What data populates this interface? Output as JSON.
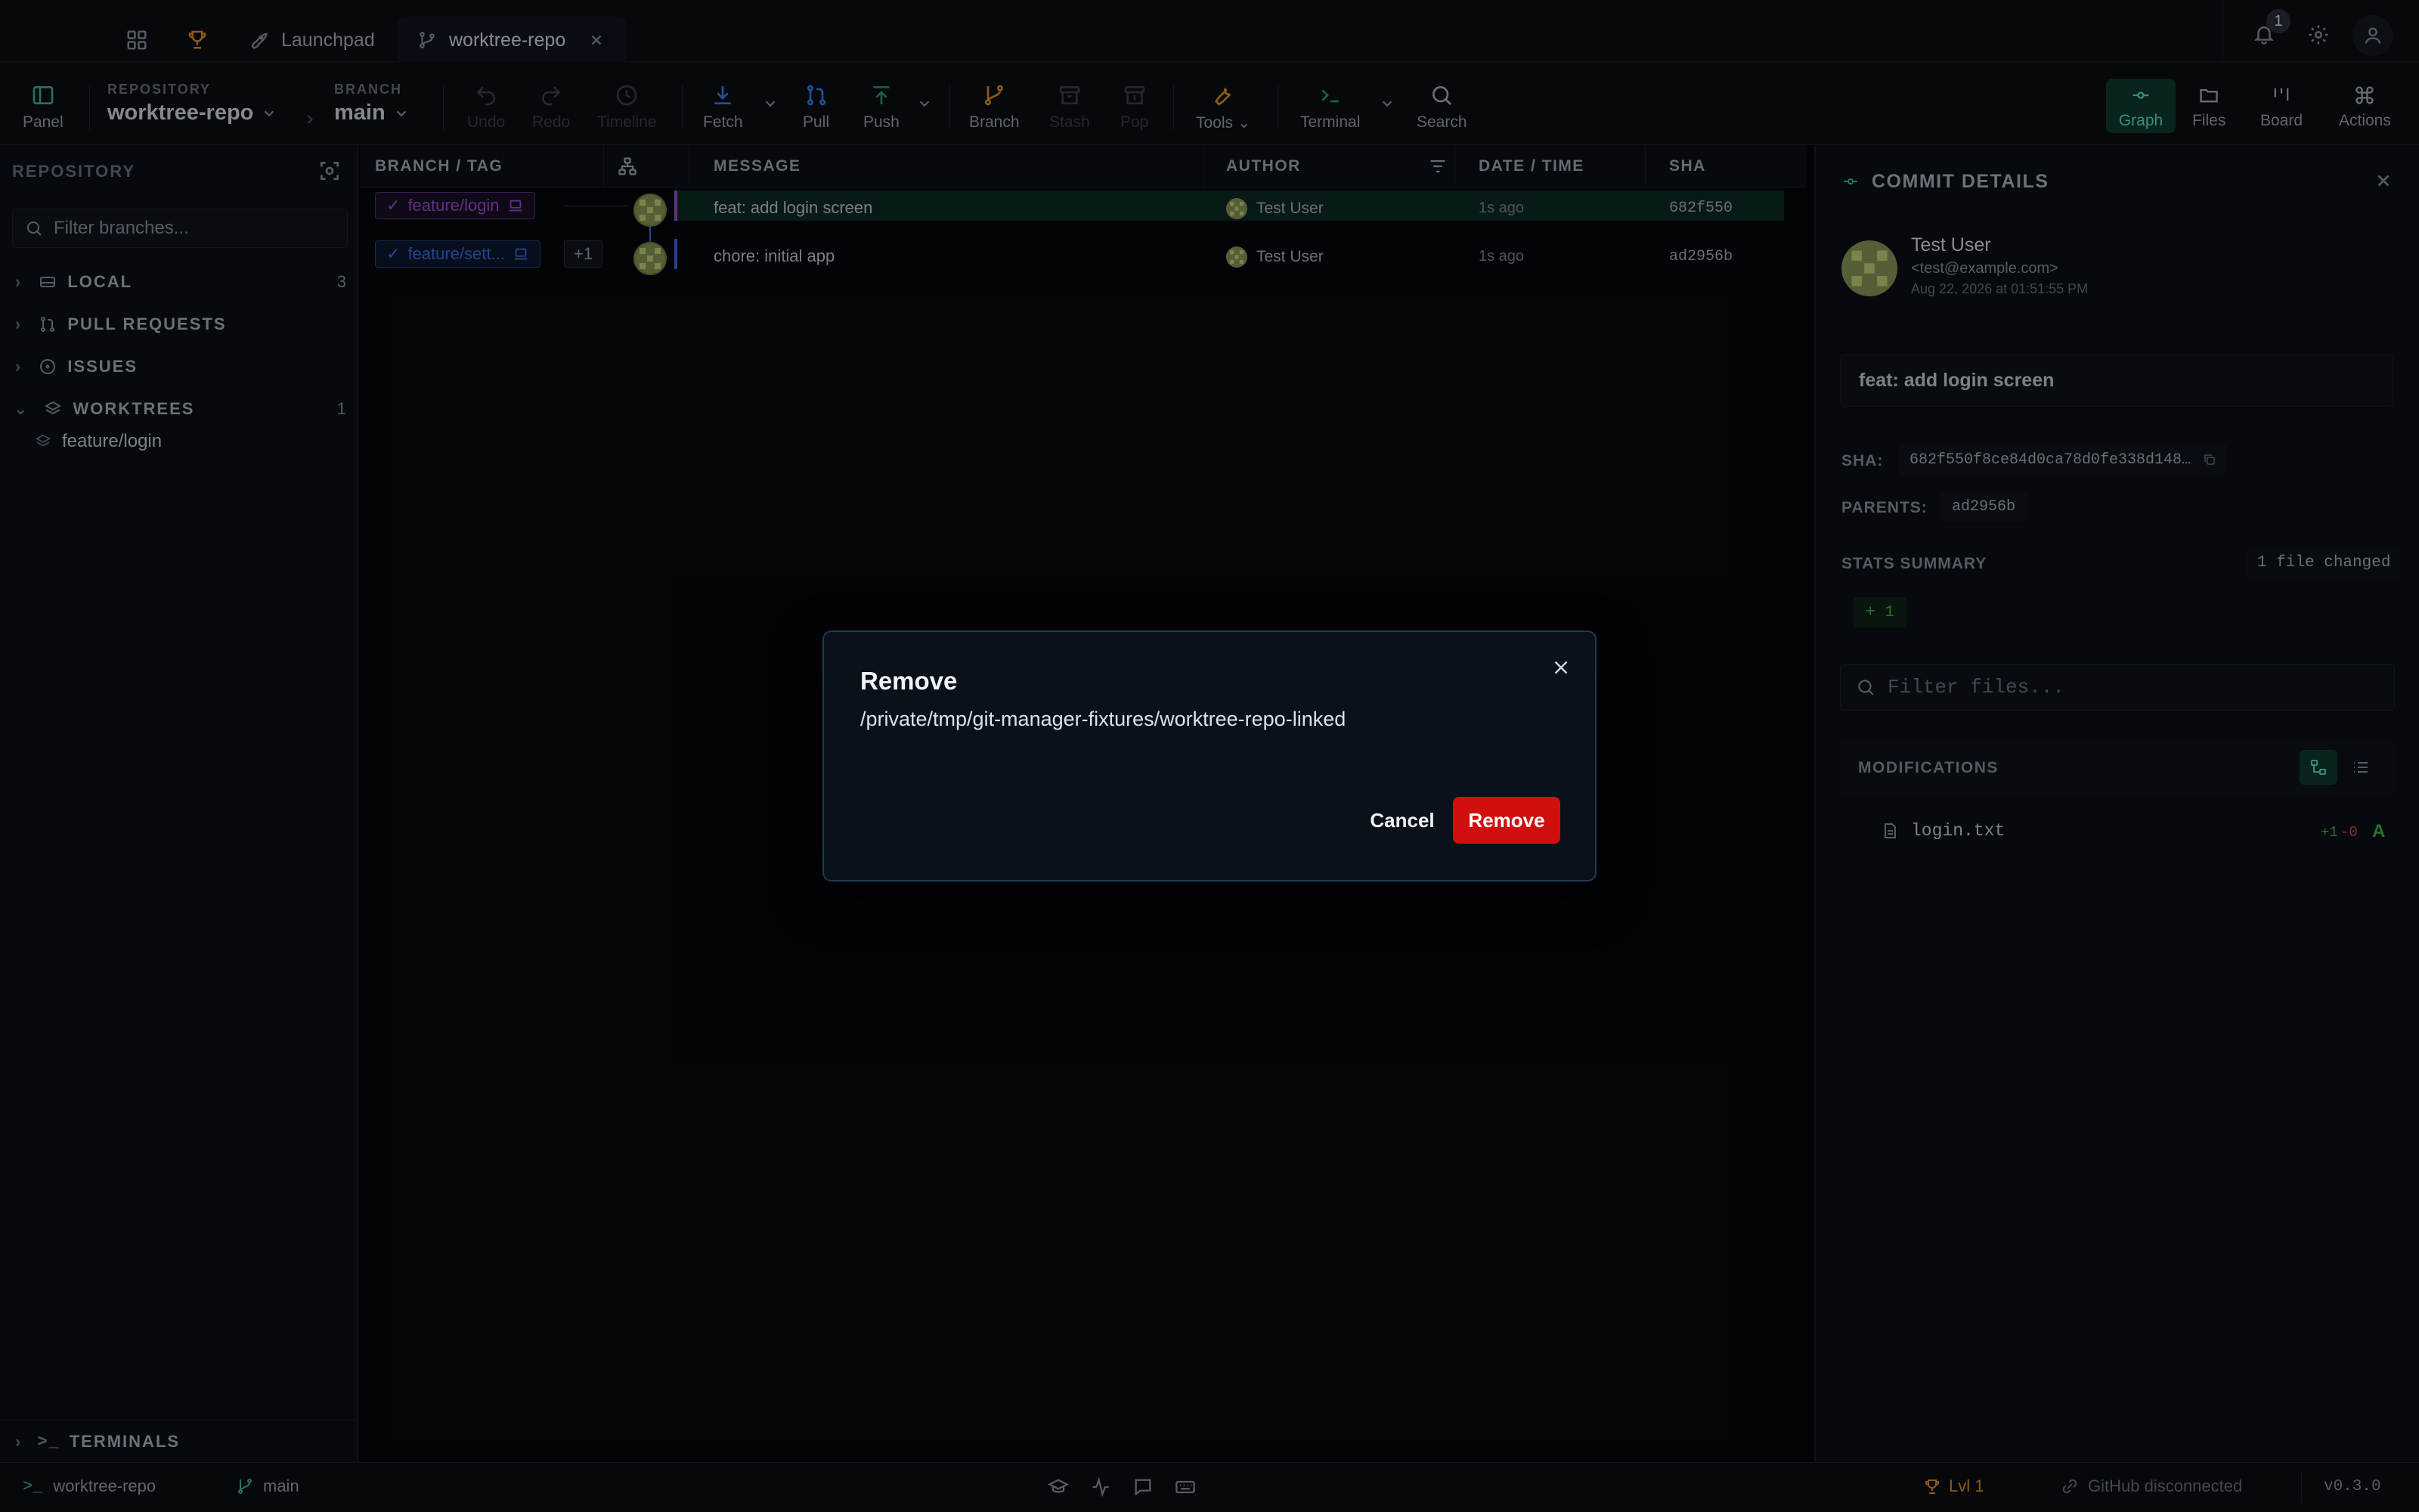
{
  "topbar": {
    "launchpad_label": "Launchpad",
    "repo_tab_label": "worktree-repo",
    "notification_count": "1"
  },
  "toolbar": {
    "panel_label": "Panel",
    "repository_caption": "REPOSITORY",
    "repository_name": "worktree-repo",
    "branch_caption": "BRANCH",
    "branch_name": "main",
    "undo_label": "Undo",
    "redo_label": "Redo",
    "timeline_label": "Timeline",
    "fetch_label": "Fetch",
    "pull_label": "Pull",
    "push_label": "Push",
    "branch_label": "Branch",
    "stash_label": "Stash",
    "pop_label": "Pop",
    "tools_label": "Tools",
    "terminal_label": "Terminal",
    "search_label": "Search",
    "graph_label": "Graph",
    "files_label": "Files",
    "board_label": "Board",
    "actions_label": "Actions"
  },
  "sidebar": {
    "title": "REPOSITORY",
    "filter_placeholder": "Filter branches...",
    "sections": [
      {
        "label": "LOCAL",
        "count": "3"
      },
      {
        "label": "PULL REQUESTS",
        "count": ""
      },
      {
        "label": "ISSUES",
        "count": ""
      },
      {
        "label": "WORKTREES",
        "count": "1"
      }
    ],
    "worktree_item": "feature/login",
    "terminals_label": "TERMINALS"
  },
  "graph": {
    "headers": {
      "branch_tag": "BRANCH / TAG",
      "message": "MESSAGE",
      "author": "AUTHOR",
      "datetime": "DATE / TIME",
      "sha": "SHA"
    },
    "rows": [
      {
        "branch": "feature/login",
        "extra": "",
        "message": "feat: add login screen",
        "author": "Test User",
        "time": "1s ago",
        "sha": "682f550"
      },
      {
        "branch": "feature/sett...",
        "extra": "+1",
        "message": "chore: initial app",
        "author": "Test User",
        "time": "1s ago",
        "sha": "ad2956b"
      }
    ]
  },
  "details": {
    "title": "COMMIT DETAILS",
    "author_name": "Test User",
    "author_email": "<test@example.com>",
    "date": "Aug 22, 2026 at 01:51:55 PM",
    "message": "feat: add login screen",
    "sha_label": "SHA:",
    "sha_value": "682f550f8ce84d0ca78d0fe338d148…",
    "parents_label": "PARENTS:",
    "parent_value": "ad2956b",
    "stats_label": "STATS SUMMARY",
    "files_changed": "1 file changed",
    "additions": "+ 1",
    "filter_placeholder": "Filter files...",
    "modifications_label": "MODIFICATIONS",
    "file_name": "login.txt",
    "file_add": "+1",
    "file_del": "-0",
    "file_status": "A"
  },
  "statusbar": {
    "repo": "worktree-repo",
    "branch": "main",
    "level": "Lvl 1",
    "github": "GitHub disconnected",
    "version": "v0.3.0"
  },
  "modal": {
    "title": "Remove",
    "path": "/private/tmp/git-manager-fixtures/worktree-repo-linked",
    "cancel_label": "Cancel",
    "confirm_label": "Remove"
  },
  "colors": {
    "accent_green": "#3fb6a0",
    "danger_red": "#d20f0f",
    "purple_branch": "#9b4fd6",
    "blue_branch": "#3b6fe0"
  }
}
